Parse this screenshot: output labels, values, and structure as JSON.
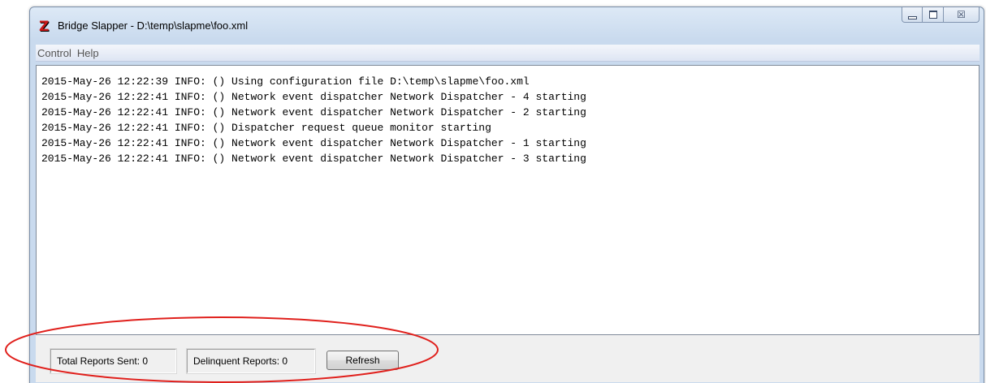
{
  "window": {
    "title": "Bridge Slapper - D:\\temp\\slapme\\foo.xml",
    "icon": "app-z-icon",
    "controls": {
      "minimize": "minimize-icon",
      "maximize": "maximize-icon",
      "close_glyph": "☒"
    }
  },
  "menubar": {
    "items": [
      {
        "label": "Control"
      },
      {
        "label": "Help"
      }
    ]
  },
  "log": {
    "lines": [
      "2015-May-26 12:22:39 INFO: () Using configuration file D:\\temp\\slapme\\foo.xml",
      "2015-May-26 12:22:41 INFO: () Network event dispatcher Network Dispatcher - 4 starting",
      "2015-May-26 12:22:41 INFO: () Network event dispatcher Network Dispatcher - 2 starting",
      "2015-May-26 12:22:41 INFO: () Dispatcher request queue monitor starting",
      "2015-May-26 12:22:41 INFO: () Network event dispatcher Network Dispatcher - 1 starting",
      "2015-May-26 12:22:41 INFO: () Network event dispatcher Network Dispatcher - 3 starting"
    ]
  },
  "status": {
    "total_reports": "Total Reports Sent: 0",
    "delinquent_reports": "Delinquent Reports: 0",
    "refresh_label": "Refresh"
  },
  "colors": {
    "annotation": "#e0201c",
    "app_icon": "#c81818"
  }
}
